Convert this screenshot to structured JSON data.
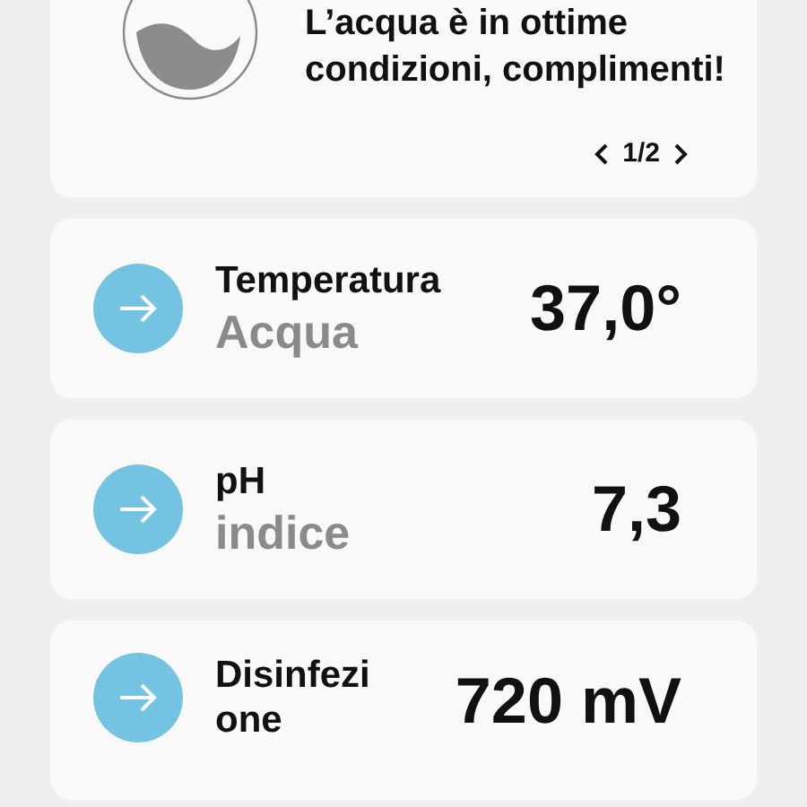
{
  "status_card": {
    "message": "L’acqua è in ottime condizioni, complimenti!",
    "pager": "1/2"
  },
  "readings": [
    {
      "title": "Temperatura",
      "subtitle": "Acqua",
      "value": "37,0°"
    },
    {
      "title": "pH",
      "subtitle": "indice",
      "value": "7,3"
    },
    {
      "title": "Disinfezione",
      "value": "720 mV"
    }
  ]
}
